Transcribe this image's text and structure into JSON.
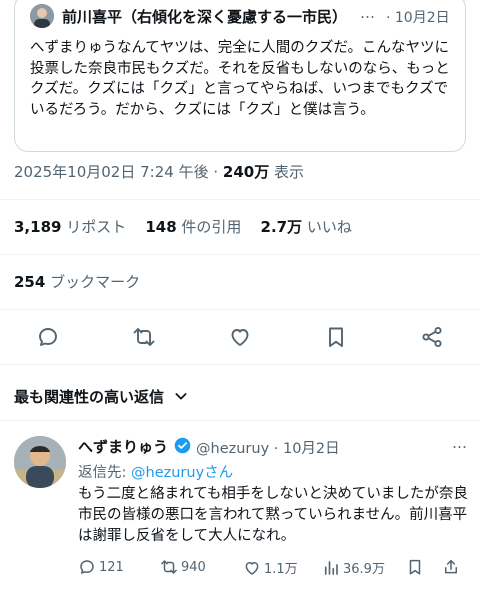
{
  "quoted_post": {
    "author_name": "前川喜平（右傾化を深く憂慮する一市民）",
    "more": "…",
    "date": "· 10月2日",
    "body": "へずまりゅうなんてヤツは、完全に人間のクズだ。こんなヤツに投票した奈良市民もクズだ。それを反省もしないのなら、もっとクズだ。クズには「クズ」と言ってやらねば、いつまでもクズでいるだろう。だから、クズには「クズ」と僕は言う。"
  },
  "post_meta": {
    "timestamp": "2025年10月02日 7:24 午後 ·",
    "views_count": "240万",
    "views_label": "表示"
  },
  "stats": {
    "reposts_count": "3,189",
    "reposts_label": "リポスト",
    "quotes_count": "148",
    "quotes_label": "件の引用",
    "likes_count": "2.7万",
    "likes_label": "いいね",
    "bookmarks_count": "254",
    "bookmarks_label": "ブックマーク"
  },
  "action_icons": [
    "reply-icon",
    "repost-icon",
    "like-icon",
    "bookmark-icon",
    "share-icon"
  ],
  "replies_section": {
    "sort_label": "最も関連性の高い返信"
  },
  "reply": {
    "author_name": "へずまりゅう",
    "handle_date": "@hezuruy · 10月2日",
    "more": "…",
    "reply_to_prefix": "返信先:",
    "reply_to_handle": "@hezuruyさん",
    "body": "もう二度と絡まれても相手をしないと決めていましたが奈良市民の皆様の悪口を言われて黙っていられません。前川喜平は謝罪し反省をして大人になれ。",
    "replies": "121",
    "reposts": "940",
    "likes": "1.1万",
    "views": "36.9万"
  },
  "colors": {
    "accent": "#1d9bf0",
    "text": "#0f1419",
    "secondary": "#536471",
    "border": "#cfd9de"
  }
}
